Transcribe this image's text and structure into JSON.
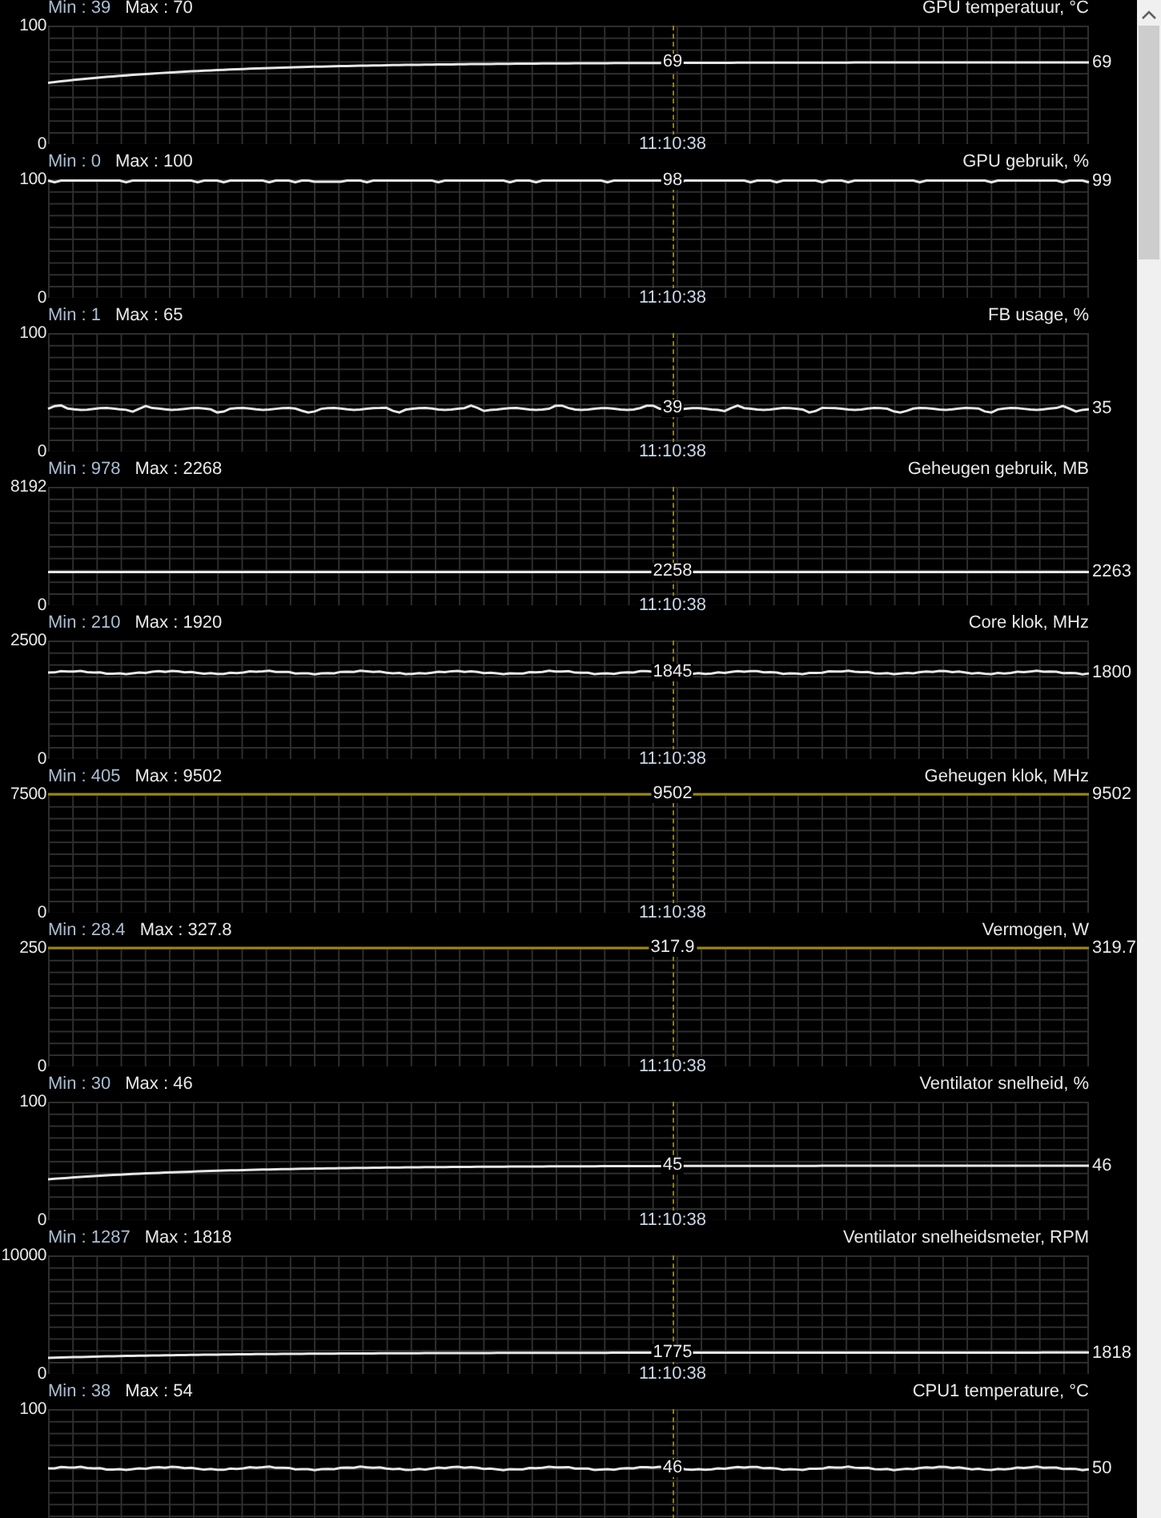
{
  "panels": [
    {
      "min_label": "Min : 39",
      "max_label": "Max : 70",
      "title": "GPU temperatuur, °C",
      "top_label": "100",
      "bottom_label": "0",
      "cursor_value": "69",
      "current_value": "69",
      "time": "11:10:38"
    },
    {
      "min_label": "Min : 0",
      "max_label": "Max : 100",
      "title": "GPU gebruik, %",
      "top_label": "100",
      "bottom_label": "0",
      "cursor_value": "98",
      "current_value": "99",
      "time": "11:10:38"
    },
    {
      "min_label": "Min : 1",
      "max_label": "Max : 65",
      "title": "FB usage, %",
      "top_label": "100",
      "bottom_label": "0",
      "cursor_value": "39",
      "current_value": "35",
      "time": "11:10:38"
    },
    {
      "min_label": "Min : 978",
      "max_label": "Max : 2268",
      "title": "Geheugen gebruik, MB",
      "top_label": "8192",
      "bottom_label": "0",
      "cursor_value": "2258",
      "current_value": "2263",
      "time": "11:10:38"
    },
    {
      "min_label": "Min : 210",
      "max_label": "Max : 1920",
      "title": "Core klok, MHz",
      "top_label": "2500",
      "bottom_label": "0",
      "cursor_value": "1845",
      "current_value": "1800",
      "time": "11:10:38"
    },
    {
      "min_label": "Min : 405",
      "max_label": "Max : 9502",
      "title": "Geheugen klok, MHz",
      "top_label": "7500",
      "bottom_label": "0",
      "cursor_value": "9502",
      "current_value": "9502",
      "time": "11:10:38"
    },
    {
      "min_label": "Min : 28.4",
      "max_label": "Max : 327.8",
      "title": "Vermogen, W",
      "top_label": "250",
      "bottom_label": "0",
      "cursor_value": "317.9",
      "current_value": "319.7",
      "time": "11:10:38"
    },
    {
      "min_label": "Min : 30",
      "max_label": "Max : 46",
      "title": "Ventilator snelheid, %",
      "top_label": "100",
      "bottom_label": "0",
      "cursor_value": "45",
      "current_value": "46",
      "time": "11:10:38"
    },
    {
      "min_label": "Min : 1287",
      "max_label": "Max : 1818",
      "title": "Ventilator snelheidsmeter, RPM",
      "top_label": "10000",
      "bottom_label": "0",
      "cursor_value": "1775",
      "current_value": "1818",
      "time": "11:10:38"
    },
    {
      "min_label": "Min : 38",
      "max_label": "Max : 54",
      "title": "CPU1 temperature, °C",
      "top_label": "100",
      "cursor_value": "46",
      "current_value": "50"
    }
  ]
}
